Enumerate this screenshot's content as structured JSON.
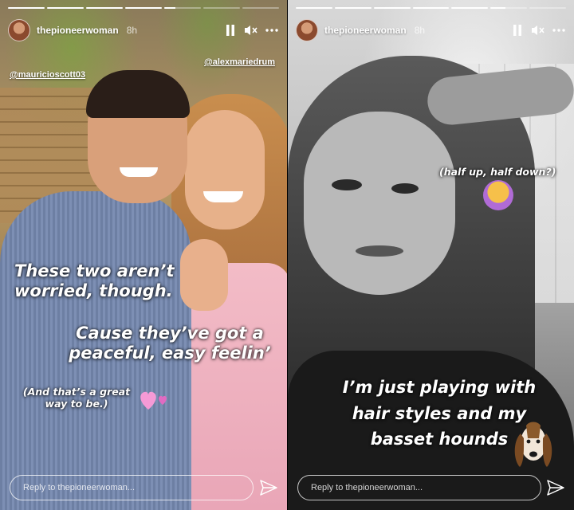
{
  "stories": [
    {
      "username": "thepioneerwoman",
      "time": "8h",
      "progress": [
        1,
        1,
        1,
        1,
        0.3,
        0,
        0
      ],
      "mentions": [
        "@mauricioscott03",
        "@alexmariedrum"
      ],
      "caption_lines_1": [
        "These two aren’t",
        "worried, though."
      ],
      "caption_lines_2": [
        "Cause they’ve got a",
        "peaceful, easy feelin’"
      ],
      "caption_lines_3": [
        "(And that’s a great",
        "way to be.)"
      ],
      "reply_placeholder": "Reply to thepioneerwoman..."
    },
    {
      "username": "thepioneerwoman",
      "time": "8h",
      "progress": [
        1,
        1,
        1,
        1,
        1,
        0.4,
        0
      ],
      "caption_top": "(half up, half down?)",
      "caption_lines": [
        "I’m just playing with",
        "hair styles and my",
        "basset hounds"
      ],
      "reply_placeholder": "Reply to thepioneerwoman..."
    }
  ],
  "icons": {
    "pause": "pause-icon",
    "mute": "mute-icon",
    "more": "more-icon",
    "send": "send-icon"
  }
}
